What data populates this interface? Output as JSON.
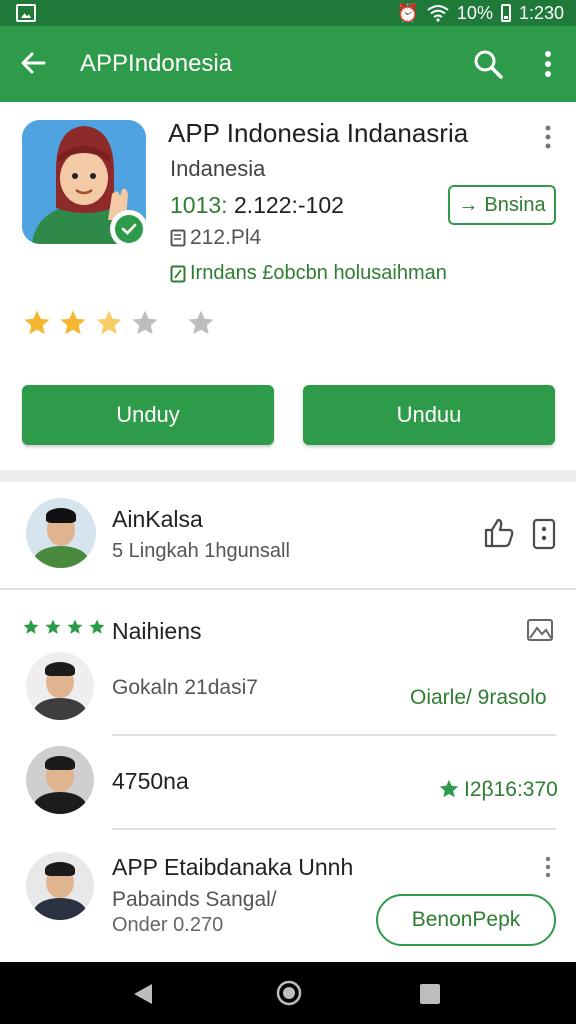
{
  "status_bar": {
    "battery": "10%",
    "time": "1:230"
  },
  "app_bar": {
    "title": "APPIndonesia",
    "back_icon": "back-arrow-icon",
    "search_icon": "search-icon",
    "more_icon": "more-vert-icon"
  },
  "app_header": {
    "title": "APP Indonesia Indanasria",
    "developer": "Indanesia",
    "version_label": "1013:",
    "version_value": "2.122:-102",
    "size": "212.Pl4",
    "tag": "Irndans £obcbn holusaihman",
    "small_button": "Bnsina",
    "rating_stars": 2.5,
    "max_stars": 5,
    "buttons": {
      "left": "Unduy",
      "right": "Unduu"
    },
    "colors": {
      "primary": "#2e9b4a",
      "star": "#f5b731",
      "star_empty": "#bdbdbd"
    }
  },
  "author_row": {
    "name": "AinKalsa",
    "subtitle": "5 Lingkah 1hgunsall"
  },
  "reviews": {
    "header_label": "Naihiens",
    "items": [
      {
        "name": "Gokaln 21dasi7",
        "meta": "Oiarle/ 9rasolo",
        "has_star": false
      },
      {
        "name": "4750na",
        "meta": "I2β16:370",
        "has_star": true
      },
      {
        "name": "APP Etaibdanaka Unnh",
        "line1": "Pabainds Sangal/",
        "line2": "Onder 0.270",
        "button": "BenonPepk"
      }
    ]
  }
}
